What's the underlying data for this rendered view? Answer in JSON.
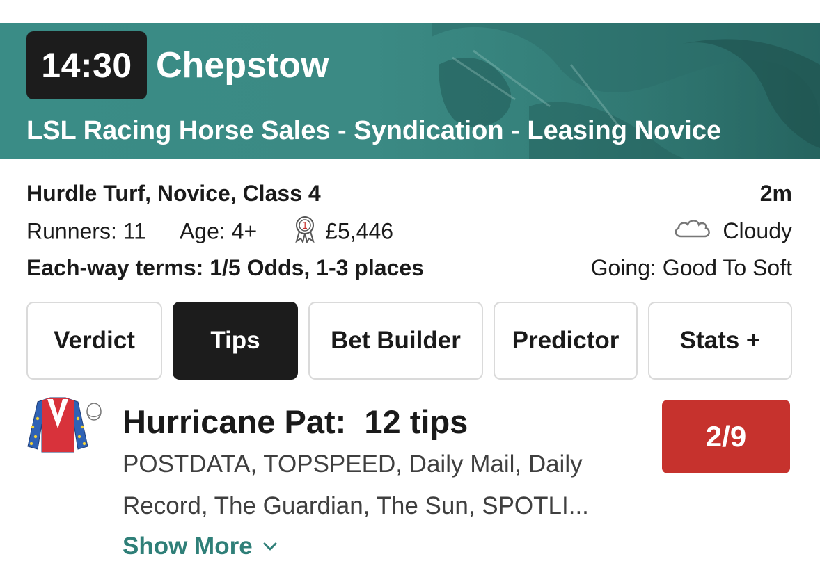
{
  "race": {
    "time": "14:30",
    "venue": "Chepstow",
    "title": "LSL Racing Horse Sales - Syndication - Leasing Novice"
  },
  "details": {
    "race_type": "Hurdle Turf, Novice, Class 4",
    "distance": "2m",
    "runners": "Runners: 11",
    "age": "Age: 4+",
    "prize": "£5,446",
    "prize_icon": "rosette-icon",
    "weather_icon": "cloud-icon",
    "weather": "Cloudy",
    "each_way": "Each-way terms: 1/5 Odds, 1-3 places",
    "going": "Going: Good To Soft"
  },
  "tabs": [
    {
      "label": "Verdict",
      "active": false
    },
    {
      "label": "Tips",
      "active": true
    },
    {
      "label": "Bet Builder",
      "active": false
    },
    {
      "label": "Predictor",
      "active": false
    },
    {
      "label": "Stats +",
      "active": false
    }
  ],
  "tip": {
    "silks_icon": "jockey-silks-icon",
    "horse": "Hurricane Pat:",
    "count": "12 tips",
    "odds": "2/9",
    "tipsters": "POSTDATA, TOPSPEED, Daily Mail, Daily Record, The Guardian, The Sun, SPOTLI...",
    "show_more": "Show More"
  },
  "colors": {
    "header_teal": "#3a8c86",
    "odds_red": "#c6322d",
    "link_teal": "#2f7f78",
    "active_tab": "#1c1c1c"
  }
}
